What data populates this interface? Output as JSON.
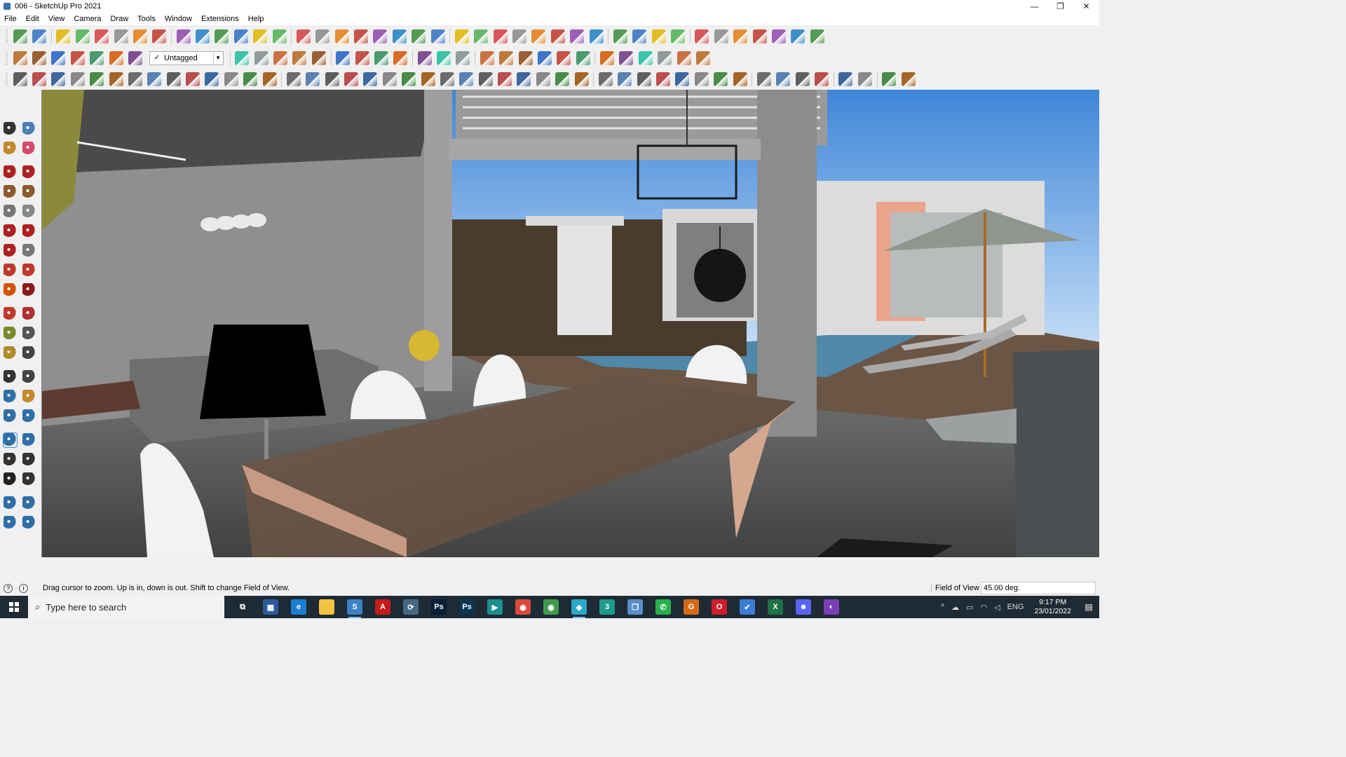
{
  "window": {
    "title": "006 - SketchUp Pro 2021",
    "min": "—",
    "max": "❐",
    "close": "✕"
  },
  "menu": [
    "File",
    "Edit",
    "View",
    "Camera",
    "Draw",
    "Tools",
    "Window",
    "Extensions",
    "Help"
  ],
  "tag_dropdown": {
    "check": "✓",
    "value": "Untagged",
    "arrow": "▼"
  },
  "status": {
    "icon1": "?",
    "icon2": "i",
    "hint": "Drag cursor to zoom.  Up is in, down is out. Shift to change Field of View.",
    "vcb_label": "Field of View",
    "vcb_value": "45.00 deg."
  },
  "taskbar": {
    "search_placeholder": "Type here to search",
    "search_icon": "⌕",
    "time": "9:17 PM",
    "date": "23/01/2022",
    "lang": "ENG",
    "apps": [
      {
        "name": "task-view",
        "glyph": "⧉",
        "color": "transparent"
      },
      {
        "name": "calculator",
        "glyph": "▦",
        "color": "#2b5a9c"
      },
      {
        "name": "edge",
        "glyph": "e",
        "color": "#1b7fd1"
      },
      {
        "name": "file-explorer",
        "glyph": "",
        "color": "#f2c341"
      },
      {
        "name": "sketchup",
        "glyph": "S",
        "color": "#3b82c4"
      },
      {
        "name": "acrobat",
        "glyph": "A",
        "color": "#c71b1b"
      },
      {
        "name": "app-x",
        "glyph": "⟳",
        "color": "#466a86"
      },
      {
        "name": "photoshop",
        "glyph": "Ps",
        "color": "#001e36"
      },
      {
        "name": "photoshop-2",
        "glyph": "Ps",
        "color": "#0b3553"
      },
      {
        "name": "app-teal",
        "glyph": "▶",
        "color": "#1b8f8f"
      },
      {
        "name": "chrome",
        "glyph": "◉",
        "color": "#d94a3b"
      },
      {
        "name": "chrome-2",
        "glyph": "◉",
        "color": "#3e9b4a"
      },
      {
        "name": "app-cyan",
        "glyph": "◆",
        "color": "#29a8c8"
      },
      {
        "name": "app-3",
        "glyph": "3",
        "color": "#1f9a8f"
      },
      {
        "name": "app-blue",
        "glyph": "❐",
        "color": "#5a8fc9"
      },
      {
        "name": "whatsapp",
        "glyph": "✆",
        "color": "#27b04c"
      },
      {
        "name": "grammarly",
        "glyph": "G",
        "color": "#d46a17"
      },
      {
        "name": "opera",
        "glyph": "O",
        "color": "#cf1e2a"
      },
      {
        "name": "app-check",
        "glyph": "✔",
        "color": "#3b7dd8"
      },
      {
        "name": "excel",
        "glyph": "X",
        "color": "#1e7145"
      },
      {
        "name": "discord",
        "glyph": "☻",
        "color": "#5865f2"
      },
      {
        "name": "app-purple",
        "glyph": "◐",
        "color": "#7a3fb5"
      }
    ]
  },
  "toolbar_rows": [
    {
      "count": 41,
      "colors": [
        "#3a8c3a",
        "#2f6fc1",
        "#e3b400",
        "#4caf50",
        "#d43c3c",
        "#888",
        "#e57b10",
        "#c0392b",
        "#8e44ad",
        "#1f7fc4"
      ]
    },
    {
      "count": 31,
      "colors": [
        "#b5651d",
        "#8b4513",
        "#1f5fbf",
        "#c0392b",
        "#2e8b57",
        "#d35400",
        "#6c3483",
        "#1abc9c",
        "#7f8c8d",
        "#c45c26"
      ]
    },
    {
      "count": 46,
      "colors": [
        "#444",
        "#b03030",
        "#1f4f8f",
        "#777",
        "#2b7a2b",
        "#994c00",
        "#555",
        "#3d6fa8"
      ]
    }
  ]
}
